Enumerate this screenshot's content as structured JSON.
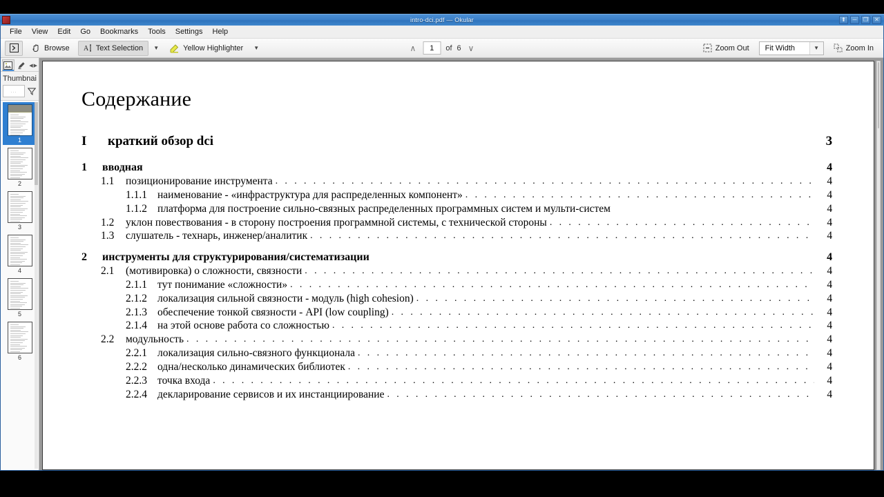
{
  "window": {
    "title": "intro-dci.pdf — Okular",
    "buttons": [
      {
        "name": "shade-button",
        "glyph": "⬆"
      },
      {
        "name": "minimize-button",
        "glyph": "─"
      },
      {
        "name": "maximize-button",
        "glyph": "❐"
      },
      {
        "name": "close-button",
        "glyph": "✕"
      }
    ]
  },
  "menubar": {
    "items": [
      "File",
      "View",
      "Edit",
      "Go",
      "Bookmarks",
      "Tools",
      "Settings",
      "Help"
    ]
  },
  "toolbar": {
    "sidebar_toggle": "show-sidebar-icon",
    "browse_label": "Browse",
    "text_selection_label": "Text Selection",
    "highlighter_label": "Yellow Highlighter",
    "zoom_out_label": "Zoom Out",
    "zoom_in_label": "Zoom In",
    "zoom_value": "Fit Width"
  },
  "page_nav": {
    "current_page": "1",
    "of_label": "of",
    "total_pages": "6",
    "prev_glyph": "∧",
    "next_glyph": "∨"
  },
  "sidebar": {
    "tabs": [
      {
        "name": "thumbnails-tab",
        "icon": "image-icon",
        "selected": true
      },
      {
        "name": "annotations-tab",
        "icon": "pen-icon",
        "selected": false
      }
    ],
    "panel_title": "Thumbnai",
    "search_placeholder": "...",
    "filter_icon": "funnel-icon",
    "thumbnails": [
      {
        "page": "1",
        "selected": true
      },
      {
        "page": "2",
        "selected": false
      },
      {
        "page": "3",
        "selected": false
      },
      {
        "page": "4",
        "selected": false
      },
      {
        "page": "5",
        "selected": false
      },
      {
        "page": "6",
        "selected": false
      }
    ]
  },
  "document": {
    "title": "Содержание",
    "toc": [
      {
        "level": "part",
        "num": "I",
        "text": "краткий обзор dci",
        "page": "3",
        "dots": false
      },
      {
        "level": "1",
        "num": "1",
        "text": "вводная",
        "page": "4",
        "dots": false
      },
      {
        "level": "2",
        "num": "1.1",
        "text": "позиционирование инструмента",
        "page": "4",
        "dots": true
      },
      {
        "level": "3",
        "num": "1.1.1",
        "text": "наименование - «инфраструктура для распределенных компонент»",
        "page": "4",
        "dots": true
      },
      {
        "level": "3",
        "num": "1.1.2",
        "text": "платформа для построение сильно-связных распределенных программных систем и мульти-систем",
        "page": "4",
        "dots": false
      },
      {
        "level": "2",
        "num": "1.2",
        "text": "уклон повествования - в сторону построения программной системы, с технической стороны",
        "page": "4",
        "dots": true
      },
      {
        "level": "2",
        "num": "1.3",
        "text": "слушатель - технарь, инженер/аналитик",
        "page": "4",
        "dots": true
      },
      {
        "level": "1",
        "num": "2",
        "text": "инструменты для структурирования/систематизации",
        "page": "4",
        "dots": false
      },
      {
        "level": "2",
        "num": "2.1",
        "text": "(мотивировка) о сложности, связности",
        "page": "4",
        "dots": true
      },
      {
        "level": "3",
        "num": "2.1.1",
        "text": "тут понимание «сложности»",
        "page": "4",
        "dots": true
      },
      {
        "level": "3",
        "num": "2.1.2",
        "text": "локализация сильной связности - модуль (high cohesion)",
        "page": "4",
        "dots": true
      },
      {
        "level": "3",
        "num": "2.1.3",
        "text": "обеспечение тонкой связности - API (low coupling)",
        "page": "4",
        "dots": true
      },
      {
        "level": "3",
        "num": "2.1.4",
        "text": "на этой основе работа со сложностью",
        "page": "4",
        "dots": true
      },
      {
        "level": "2",
        "num": "2.2",
        "text": "модульность",
        "page": "4",
        "dots": true
      },
      {
        "level": "3",
        "num": "2.2.1",
        "text": "локализация сильно-связного функционала",
        "page": "4",
        "dots": true
      },
      {
        "level": "3",
        "num": "2.2.2",
        "text": "одна/несколько динамических библиотек",
        "page": "4",
        "dots": true
      },
      {
        "level": "3",
        "num": "2.2.3",
        "text": "точка входа",
        "page": "4",
        "dots": true
      },
      {
        "level": "3",
        "num": "2.2.4",
        "text": "декларирование сервисов и их инстанциирование",
        "page": "4",
        "dots": true
      }
    ]
  },
  "colors": {
    "titlebar": "#3c81c9",
    "selection": "#2f7fd1",
    "accent": "#4a90d9"
  }
}
